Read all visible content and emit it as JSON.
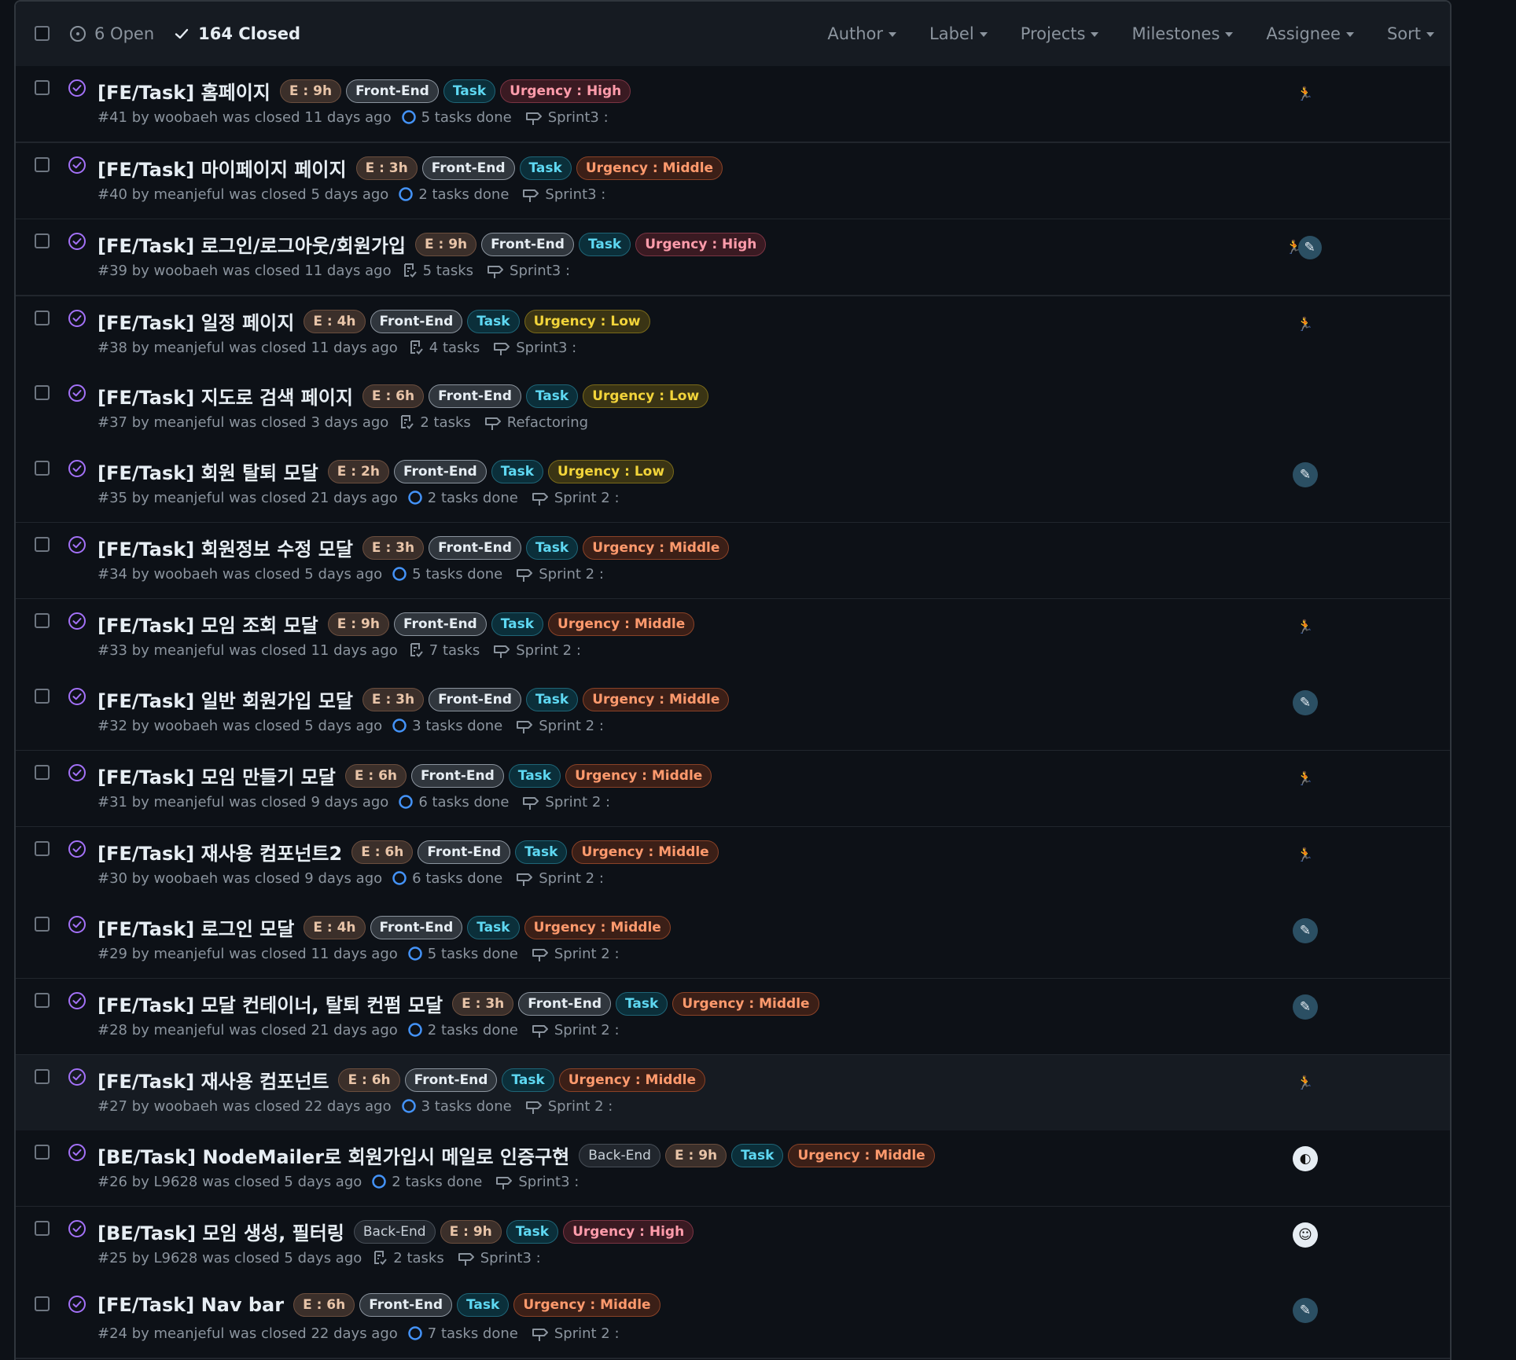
{
  "header": {
    "open_label": "6 Open",
    "closed_label": "164 Closed",
    "filters": [
      "Author",
      "Label",
      "Projects",
      "Milestones",
      "Assignee",
      "Sort"
    ]
  },
  "issues": [
    {
      "title": "[FE/Task] 홈페이지",
      "labels": [
        {
          "text": "E : 9h",
          "kind": "est"
        },
        {
          "text": "Front-End",
          "kind": "fe"
        },
        {
          "text": "Task",
          "kind": "task"
        },
        {
          "text": "Urgency : High",
          "kind": "high"
        }
      ],
      "meta": "#41 by woobaeh was closed 11 days ago",
      "tasks": "5 tasks done",
      "tasks_icon": "progress-circle-icon",
      "milestone": "Sprint3 :",
      "avatar": "runner"
    },
    {
      "title": "[FE/Task] 마이페이지 페이지",
      "labels": [
        {
          "text": "E : 3h",
          "kind": "est"
        },
        {
          "text": "Front-End",
          "kind": "fe"
        },
        {
          "text": "Task",
          "kind": "task"
        },
        {
          "text": "Urgency : Middle",
          "kind": "middle"
        }
      ],
      "meta": "#40 by meanjeful was closed 5 days ago",
      "tasks": "2 tasks done",
      "tasks_icon": "progress-circle-icon",
      "milestone": "Sprint3 :",
      "avatar": ""
    },
    {
      "title": "[FE/Task] 로그인/로그아웃/회원가입",
      "labels": [
        {
          "text": "E : 9h",
          "kind": "est"
        },
        {
          "text": "Front-End",
          "kind": "fe"
        },
        {
          "text": "Task",
          "kind": "task"
        },
        {
          "text": "Urgency : High",
          "kind": "high"
        }
      ],
      "meta": "#39 by woobaeh was closed 11 days ago",
      "tasks": "5 tasks",
      "tasks_icon": "checklist-icon",
      "milestone": "Sprint3 :",
      "avatar": "pair"
    },
    {
      "title": "[FE/Task] 일정 페이지",
      "labels": [
        {
          "text": "E : 4h",
          "kind": "est"
        },
        {
          "text": "Front-End",
          "kind": "fe"
        },
        {
          "text": "Task",
          "kind": "task"
        },
        {
          "text": "Urgency : Low",
          "kind": "low"
        }
      ],
      "meta": "#38 by meanjeful was closed 11 days ago",
      "tasks": "4 tasks",
      "tasks_icon": "checklist-icon",
      "milestone": "Sprint3 :",
      "avatar": "runner"
    },
    {
      "title": "[FE/Task] 지도로 검색 페이지",
      "labels": [
        {
          "text": "E : 6h",
          "kind": "est"
        },
        {
          "text": "Front-End",
          "kind": "fe"
        },
        {
          "text": "Task",
          "kind": "task"
        },
        {
          "text": "Urgency : Low",
          "kind": "low"
        }
      ],
      "meta": "#37 by meanjeful was closed 3 days ago",
      "tasks": "2 tasks",
      "tasks_icon": "checklist-icon",
      "milestone": "Refactoring",
      "avatar": ""
    },
    {
      "title": "[FE/Task] 회원 탈퇴 모달",
      "labels": [
        {
          "text": "E : 2h",
          "kind": "est"
        },
        {
          "text": "Front-End",
          "kind": "fe"
        },
        {
          "text": "Task",
          "kind": "task"
        },
        {
          "text": "Urgency : Low",
          "kind": "low"
        }
      ],
      "meta": "#35 by meanjeful was closed 21 days ago",
      "tasks": "2 tasks done",
      "tasks_icon": "progress-circle-icon",
      "milestone": "Sprint 2 :",
      "avatar": "pencil"
    },
    {
      "title": "[FE/Task] 회원정보 수정 모달",
      "labels": [
        {
          "text": "E : 3h",
          "kind": "est"
        },
        {
          "text": "Front-End",
          "kind": "fe"
        },
        {
          "text": "Task",
          "kind": "task"
        },
        {
          "text": "Urgency : Middle",
          "kind": "middle"
        }
      ],
      "meta": "#34 by woobaeh was closed 5 days ago",
      "tasks": "5 tasks done",
      "tasks_icon": "progress-circle-icon",
      "milestone": "Sprint 2 :",
      "avatar": ""
    },
    {
      "title": "[FE/Task] 모임 조회 모달",
      "labels": [
        {
          "text": "E : 9h",
          "kind": "est"
        },
        {
          "text": "Front-End",
          "kind": "fe"
        },
        {
          "text": "Task",
          "kind": "task"
        },
        {
          "text": "Urgency : Middle",
          "kind": "middle"
        }
      ],
      "meta": "#33 by meanjeful was closed 11 days ago",
      "tasks": "7 tasks",
      "tasks_icon": "checklist-icon",
      "milestone": "Sprint 2 :",
      "avatar": "runner"
    },
    {
      "title": "[FE/Task] 일반 회원가입 모달",
      "labels": [
        {
          "text": "E : 3h",
          "kind": "est"
        },
        {
          "text": "Front-End",
          "kind": "fe"
        },
        {
          "text": "Task",
          "kind": "task"
        },
        {
          "text": "Urgency : Middle",
          "kind": "middle"
        }
      ],
      "meta": "#32 by woobaeh was closed 5 days ago",
      "tasks": "3 tasks done",
      "tasks_icon": "progress-circle-icon",
      "milestone": "Sprint 2 :",
      "avatar": "pencil"
    },
    {
      "title": "[FE/Task] 모임 만들기 모달",
      "labels": [
        {
          "text": "E : 6h",
          "kind": "est"
        },
        {
          "text": "Front-End",
          "kind": "fe"
        },
        {
          "text": "Task",
          "kind": "task"
        },
        {
          "text": "Urgency : Middle",
          "kind": "middle"
        }
      ],
      "meta": "#31 by meanjeful was closed 9 days ago",
      "tasks": "6 tasks done",
      "tasks_icon": "progress-circle-icon",
      "milestone": "Sprint 2 :",
      "avatar": "runner"
    },
    {
      "title": "[FE/Task] 재사용 컴포넌트2",
      "labels": [
        {
          "text": "E : 6h",
          "kind": "est"
        },
        {
          "text": "Front-End",
          "kind": "fe"
        },
        {
          "text": "Task",
          "kind": "task"
        },
        {
          "text": "Urgency : Middle",
          "kind": "middle"
        }
      ],
      "meta": "#30 by woobaeh was closed 9 days ago",
      "tasks": "6 tasks done",
      "tasks_icon": "progress-circle-icon",
      "milestone": "Sprint 2 :",
      "avatar": "runner"
    },
    {
      "title": "[FE/Task] 로그인 모달",
      "labels": [
        {
          "text": "E : 4h",
          "kind": "est"
        },
        {
          "text": "Front-End",
          "kind": "fe"
        },
        {
          "text": "Task",
          "kind": "task"
        },
        {
          "text": "Urgency : Middle",
          "kind": "middle"
        }
      ],
      "meta": "#29 by meanjeful was closed 11 days ago",
      "tasks": "5 tasks done",
      "tasks_icon": "progress-circle-icon",
      "milestone": "Sprint 2 :",
      "avatar": "pencil"
    },
    {
      "title": "[FE/Task] 모달 컨테이너, 탈퇴 컨펌 모달",
      "labels": [
        {
          "text": "E : 3h",
          "kind": "est"
        },
        {
          "text": "Front-End",
          "kind": "fe"
        },
        {
          "text": "Task",
          "kind": "task"
        },
        {
          "text": "Urgency : Middle",
          "kind": "middle"
        }
      ],
      "meta": "#28 by meanjeful was closed 21 days ago",
      "tasks": "2 tasks done",
      "tasks_icon": "progress-circle-icon",
      "milestone": "Sprint 2 :",
      "avatar": "pencil"
    },
    {
      "title": "[FE/Task] 재사용 컴포넌트",
      "labels": [
        {
          "text": "E : 6h",
          "kind": "est"
        },
        {
          "text": "Front-End",
          "kind": "fe"
        },
        {
          "text": "Task",
          "kind": "task"
        },
        {
          "text": "Urgency : Middle",
          "kind": "middle"
        }
      ],
      "meta": "#27 by woobaeh was closed 22 days ago",
      "tasks": "3 tasks done",
      "tasks_icon": "progress-circle-icon",
      "milestone": "Sprint 2 :",
      "avatar": "runner",
      "hover": true
    },
    {
      "title": "[BE/Task] NodeMailer로 회원가입시 메일로 인증구현",
      "labels": [
        {
          "text": "Back-End",
          "kind": "be"
        },
        {
          "text": "E : 9h",
          "kind": "est"
        },
        {
          "text": "Task",
          "kind": "task"
        },
        {
          "text": "Urgency : Middle",
          "kind": "middle"
        }
      ],
      "meta": "#26 by L9628 was closed 5 days ago",
      "tasks": "2 tasks done",
      "tasks_icon": "progress-circle-icon",
      "milestone": "Sprint3 :",
      "avatar": "globe"
    },
    {
      "title": "[BE/Task] 모임 생성, 필터링",
      "labels": [
        {
          "text": "Back-End",
          "kind": "be"
        },
        {
          "text": "E : 9h",
          "kind": "est"
        },
        {
          "text": "Task",
          "kind": "task"
        },
        {
          "text": "Urgency : High",
          "kind": "high"
        }
      ],
      "meta": "#25 by L9628 was closed 5 days ago",
      "tasks": "2 tasks",
      "tasks_icon": "checklist-icon",
      "milestone": "Sprint3 :",
      "avatar": "person"
    },
    {
      "title": "[FE/Task] Nav bar",
      "labels": [
        {
          "text": "E : 6h",
          "kind": "est"
        },
        {
          "text": "Front-End",
          "kind": "fe"
        },
        {
          "text": "Task",
          "kind": "task"
        },
        {
          "text": "Urgency : Middle",
          "kind": "middle"
        }
      ],
      "meta": "#24 by meanjeful was closed 22 days ago",
      "tasks": "7 tasks done",
      "tasks_icon": "progress-circle-icon",
      "milestone": "Sprint 2 :",
      "avatar": "pencil"
    }
  ]
}
